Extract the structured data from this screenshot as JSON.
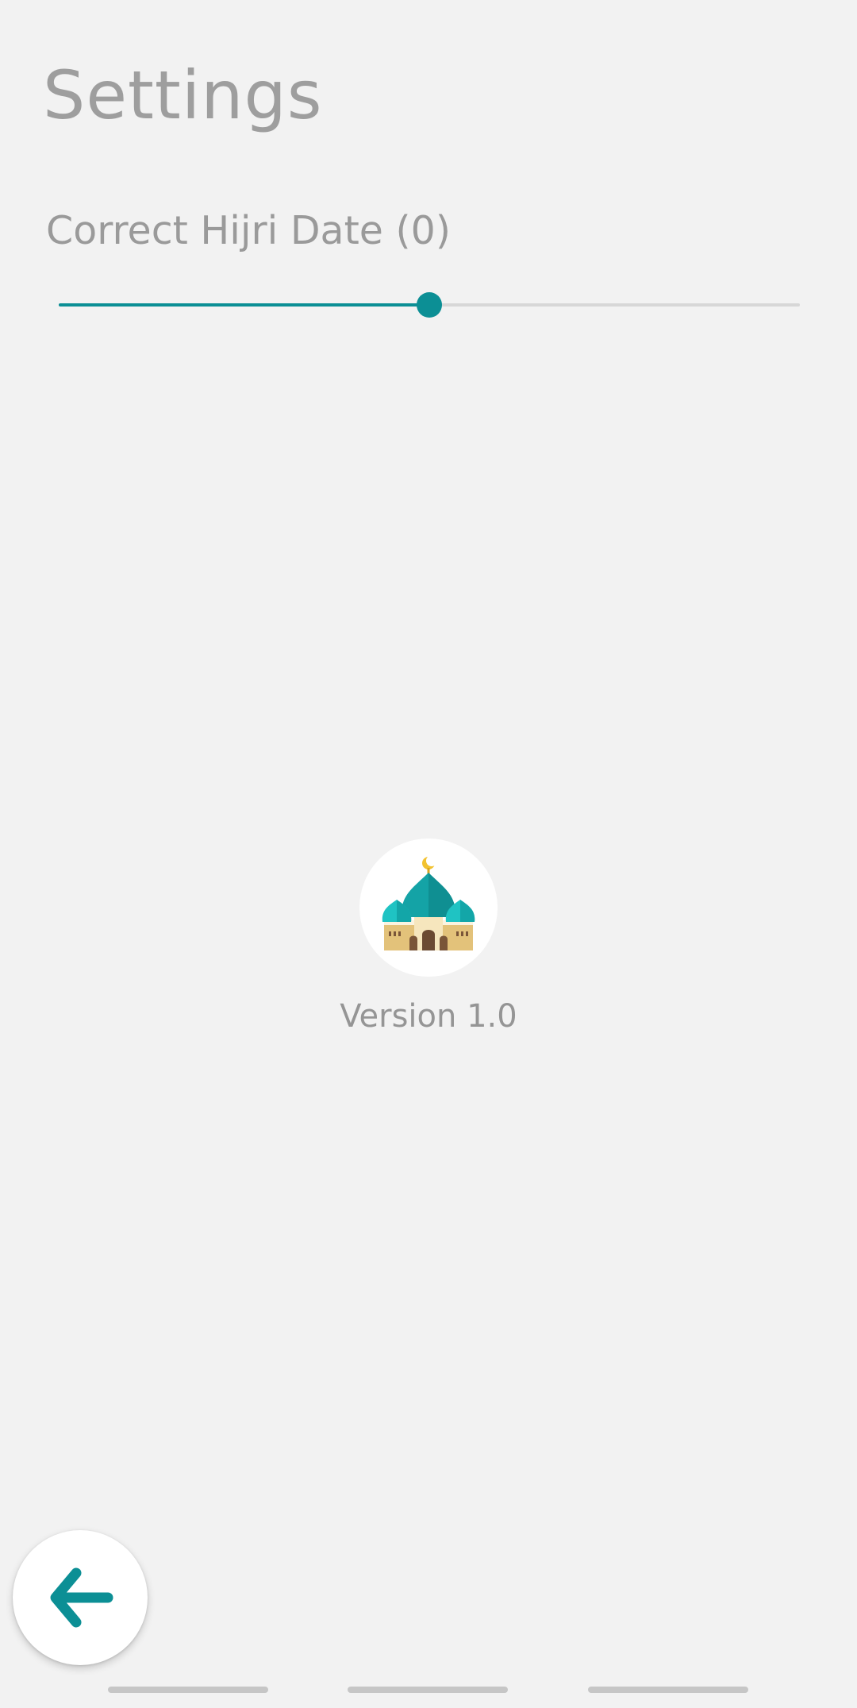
{
  "header": {
    "title": "Settings"
  },
  "settings": {
    "hijri_correction": {
      "label": "Correct Hijri Date (0)",
      "value": 0,
      "min": -2,
      "max": 2,
      "accent_color": "#0c8f95",
      "track_color": "#d7d7d7"
    }
  },
  "about": {
    "logo_icon": "mosque-icon",
    "version_text": "Version 1.0"
  },
  "fab": {
    "icon": "arrow-left-icon",
    "color": "#0c8f95"
  },
  "system_nav": {
    "handles": 3
  }
}
